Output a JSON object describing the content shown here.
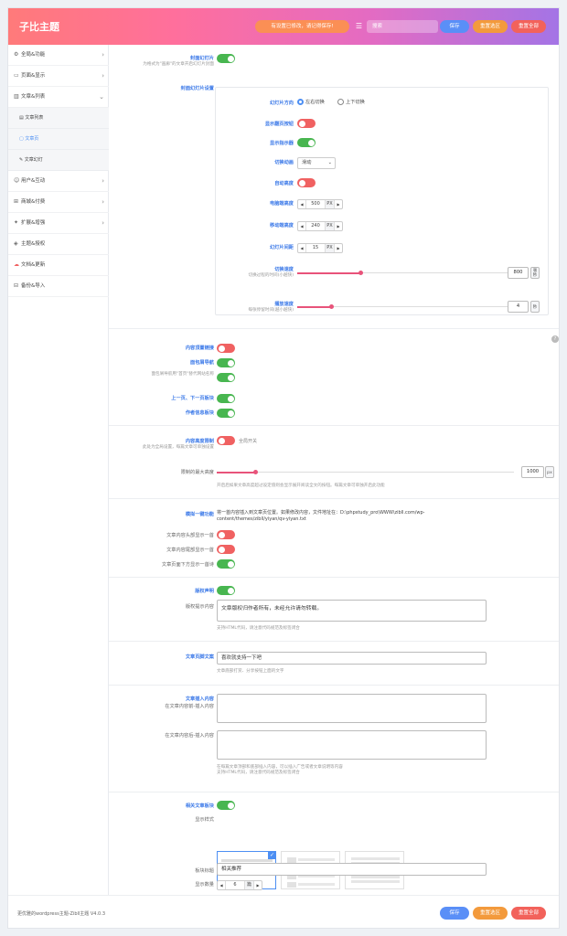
{
  "header": {
    "brand": "子比主题",
    "notice": "有设置已修改，请记得保存!",
    "search_placeholder": "搜索",
    "save": "保存",
    "reset_section": "重置选区",
    "reset_all": "重置全部"
  },
  "sidebar": {
    "items": [
      {
        "icon": "gear-icon",
        "label": "全局&功能"
      },
      {
        "icon": "page-icon",
        "label": "页面&显示"
      },
      {
        "icon": "article-icon",
        "label": "文章&列表"
      },
      {
        "icon": "user-icon",
        "label": "用户&互动"
      },
      {
        "icon": "cart-icon",
        "label": "商城&付费"
      },
      {
        "icon": "puzzle-icon",
        "label": "扩展&增强"
      },
      {
        "icon": "shield-icon",
        "label": "主题&授权"
      },
      {
        "icon": "cloud-icon",
        "label": "文档&更新"
      },
      {
        "icon": "backup-icon",
        "label": "备份&导入"
      }
    ],
    "subitems": [
      {
        "icon": "doc-icon",
        "label": "文章列表"
      },
      {
        "icon": "page-icon",
        "label": "文章页"
      },
      {
        "icon": "pin-icon",
        "label": "文章幻灯"
      }
    ]
  },
  "slider": {
    "label": "封面幻灯片",
    "desc": "为格式为\"画廊\"的文章开启幻灯片封面",
    "settings_label": "封面幻灯片设置",
    "direction_label": "幻灯片方向",
    "direction_opt1": "左右切换",
    "direction_opt2": "上下切换",
    "pager_label": "显示翻页按钮",
    "indicator_label": "显示指示器",
    "effect_label": "切换动画",
    "effect_value": "滑动",
    "auto_height_label": "自动高度",
    "pc_height_label": "电脑端高度",
    "pc_height": "500",
    "mobile_height_label": "移动端高度",
    "mobile_height": "240",
    "gap_label": "幻灯片间距",
    "gap": "15",
    "unit_px": "PX",
    "speed_label": "切换速度",
    "speed_desc": "切换过程的时间(小越快)",
    "speed_value": "800",
    "speed_unit": "毫秒",
    "interval_label": "播放速度",
    "interval_desc": "每张停留时间(越小越快)",
    "interval_value": "4",
    "interval_unit": "秒",
    "speed_fraction": 0.3,
    "interval_fraction": 0.16
  },
  "toggles": {
    "t1": "内容顶置链接",
    "t2": "面包屑导航",
    "t3_desc": "面包屑导航用\"首页\"替代网站名称",
    "t4": "上一页、下一页板块",
    "t5": "作者信息板块"
  },
  "maxheight": {
    "label": "内容高度限制",
    "desc": "此处为全局设置，每篇文章可单独设置",
    "switch_text": "全局开关",
    "height_label": "限制的最大高度",
    "height_value": "1000",
    "unit": "px",
    "note": "开启后如果文章高度超过设定值则会显示展开阅读全文的按钮。每篇文章可单独开启此功能",
    "fraction": 0.13
  },
  "onekey": {
    "label": "模拟一键功能",
    "desc": "将一首内容插入到文章页位置。如果修改内容，文件地址在：D:\\phpstudy_pro\\WWW\\zibll.com/wp-content/themes/zibll/yiyan/qv-yiyan.txt",
    "o1": "文章内容头部显示一首",
    "o2": "文章内容尾部显示一首",
    "o3": "文章页面下方显示一首诗"
  },
  "copyright": {
    "label": "版权声明",
    "content_label": "版权提示内容",
    "content": "文章版权归作者所有，未经允许请勿转载。",
    "note": "支持HTML代码，请注意代码规范及标签闭合"
  },
  "bottom_text": {
    "label": "文章页脚文案",
    "value": "喜欢就支持一下吧",
    "note": "文章底部打赏、分享按钮上面的文字"
  },
  "insert": {
    "label": "文章插入内容",
    "top_label": "在文章内容前-插入内容",
    "bottom_label": "在文章内容后-插入内容",
    "note": "在每篇文章顶部和底部插入内容，可以插入广告或者文章说明等内容\n支持HTML代码，请注意代码规范及标签闭合"
  },
  "related": {
    "label": "相关文章板块",
    "style_label": "显示样式",
    "title_label": "板块标题",
    "title_value": "相关推荐",
    "count_label": "显示数量",
    "count_value": "6",
    "count_unit": "篇"
  },
  "footer": {
    "text": "更优雅的wordpress主题-Zibll主题 V4.0.3",
    "save": "保存",
    "reset_section": "重置选区",
    "reset_all": "重置全部"
  },
  "colors": {
    "accent_blue": "#3a78e8",
    "toggle_on": "#48b650",
    "toggle_off": "#f06161",
    "slider": "#e8537a"
  }
}
